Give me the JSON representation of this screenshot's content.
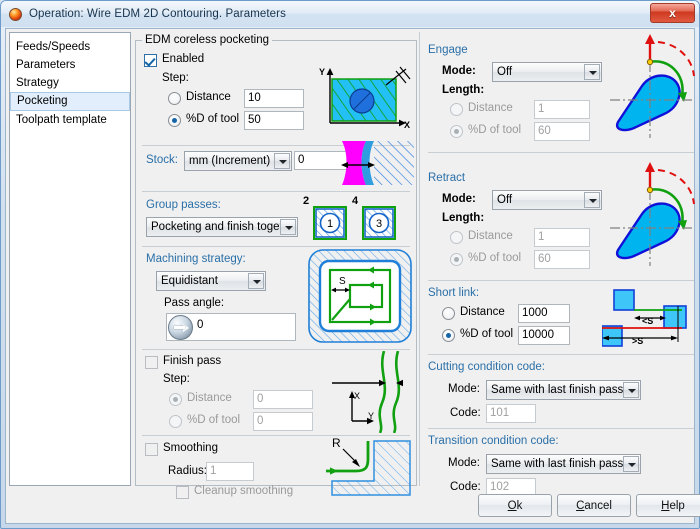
{
  "window": {
    "title": "Operation: Wire EDM 2D Contouring. Parameters",
    "icon": "sphere-icon",
    "close_label": "x"
  },
  "sidebar": {
    "items": [
      {
        "label": "Feeds/Speeds",
        "selected": false
      },
      {
        "label": "Parameters",
        "selected": false
      },
      {
        "label": "Strategy",
        "selected": false
      },
      {
        "label": "Pocketing",
        "selected": true
      },
      {
        "label": "Toolpath template",
        "selected": false
      }
    ]
  },
  "pocketing": {
    "group_title": "EDM coreless pocketing",
    "enabled": {
      "label": "Enabled",
      "checked": true
    },
    "step": {
      "label": "Step:",
      "distance": {
        "label": "Distance",
        "selected": false,
        "value": "10"
      },
      "pct_d_of_tool": {
        "label": "%D of tool",
        "selected": true,
        "value": "50"
      }
    },
    "stock": {
      "label": "Stock:",
      "unit": "mm (Increment)",
      "value": "0"
    },
    "group_passes": {
      "label": "Group passes:",
      "mode": "Pocketing and finish togetl",
      "icons": [
        {
          "badge": "2",
          "number": "1"
        },
        {
          "badge": "4",
          "number": "3"
        }
      ]
    },
    "machining_strategy": {
      "label": "Machining strategy:",
      "value": "Equidistant",
      "diagram_label": "S"
    },
    "pass_angle": {
      "label": "Pass angle:",
      "value": "0"
    },
    "finish_pass": {
      "label": "Finish pass",
      "checked": false,
      "step_label": "Step:",
      "distance": {
        "label": "Distance",
        "selected": true,
        "value": "0"
      },
      "pct_d_of_tool": {
        "label": "%D of tool",
        "selected": false,
        "value": "0"
      },
      "axis_x": "X",
      "axis_y": "Y"
    },
    "smoothing": {
      "label": "Smoothing",
      "checked": false,
      "radius_label": "Radius:",
      "radius_value": "1",
      "cleanup_label": "Cleanup smoothing",
      "cleanup_checked": false,
      "diagram_label": "R"
    },
    "diagram_axes": {
      "x": "X",
      "y": "Y"
    }
  },
  "engage": {
    "title": "Engage",
    "mode_label": "Mode:",
    "mode_value": "Off",
    "length_label": "Length:",
    "distance": {
      "label": "Distance",
      "selected": false,
      "value": "1"
    },
    "pct_d_of_tool": {
      "label": "%D of tool",
      "selected": true,
      "value": "60"
    }
  },
  "retract": {
    "title": "Retract",
    "mode_label": "Mode:",
    "mode_value": "Off",
    "length_label": "Length:",
    "distance": {
      "label": "Distance",
      "selected": false,
      "value": "1"
    },
    "pct_d_of_tool": {
      "label": "%D of tool",
      "selected": true,
      "value": "60"
    }
  },
  "short_link": {
    "title": "Short link:",
    "distance": {
      "label": "Distance",
      "selected": false,
      "value": "1000"
    },
    "pct_d_of_tool": {
      "label": "%D of tool",
      "selected": true,
      "value": "10000"
    },
    "diagram_labels": {
      "less": "<S",
      "greater": ">S"
    }
  },
  "cutting_condition": {
    "title": "Cutting condition code:",
    "mode_label": "Mode:",
    "mode_value": "Same with last finish pass",
    "code_label": "Code:",
    "code_value": "101"
  },
  "transition_condition": {
    "title": "Transition condition code:",
    "mode_label": "Mode:",
    "mode_value": "Same with last finish pass",
    "code_label": "Code:",
    "code_value": "102"
  },
  "buttons": {
    "ok": "Ok",
    "cancel": "Cancel",
    "help": "Help"
  },
  "colors": {
    "accent_blue": "#2a6fa8",
    "cyan_fill": "#00b4f0",
    "green_path": "#10a010",
    "magenta_stock": "#ff00ff",
    "red_arrow": "#e01010",
    "title_close": "#cf3a21"
  }
}
